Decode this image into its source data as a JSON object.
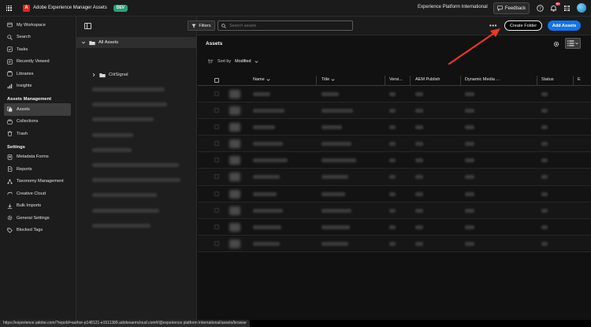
{
  "topbar": {
    "app_title": "Adobe Experience Manager Assets",
    "env_badge": "DEV",
    "org_name": "Experience Platform International",
    "feedback_label": "Feedback",
    "notification_count": "9+"
  },
  "sidebar": {
    "items": [
      {
        "label": "My Workspace",
        "icon": "home-icon"
      },
      {
        "label": "Search",
        "icon": "search-icon"
      },
      {
        "label": "Tasks",
        "icon": "tasks-icon"
      },
      {
        "label": "Recently Viewed",
        "icon": "recent-icon"
      },
      {
        "label": "Libraries",
        "icon": "library-icon"
      },
      {
        "label": "Insights",
        "icon": "insights-icon"
      }
    ],
    "section_assets": "Assets Management",
    "assets_items": [
      {
        "label": "Assets",
        "icon": "assets-icon",
        "active": true
      },
      {
        "label": "Collections",
        "icon": "collections-icon"
      },
      {
        "label": "Trash",
        "icon": "trash-icon"
      }
    ],
    "section_settings": "Settings",
    "settings_items": [
      {
        "label": "Metadata Forms",
        "icon": "forms-icon"
      },
      {
        "label": "Reports",
        "icon": "reports-icon"
      },
      {
        "label": "Taxonomy Management",
        "icon": "taxonomy-icon"
      },
      {
        "label": "Creative Cloud",
        "icon": "creative-cloud-icon"
      },
      {
        "label": "Bulk Imports",
        "icon": "bulk-import-icon"
      },
      {
        "label": "General Settings",
        "icon": "settings-icon"
      },
      {
        "label": "Blocked Tags",
        "icon": "blocked-tags-icon"
      }
    ]
  },
  "tree": {
    "root_label": "All Assets",
    "first_folder": "CitiSignal"
  },
  "toolbar": {
    "filters_label": "Filters",
    "search_placeholder": "Search assets",
    "create_folder_label": "Create Folder",
    "add_assets_label": "Add Assets"
  },
  "main": {
    "title": "Assets",
    "sort_label": "Sort by",
    "sort_value": "Modified"
  },
  "table": {
    "columns": [
      "Name",
      "Title",
      "Versi...",
      "AEM Publish",
      "Dynamic Media ...",
      "Status",
      "E"
    ]
  },
  "status_url": "https://experience.adobe.com/?repoId=author-p148121-e1511389.adobeaemcloud.com#/@experience platform international/assets/browse",
  "colors": {
    "accent": "#1473e6",
    "badge": "#2d9d78",
    "annotation_arrow": "#e8382a"
  }
}
